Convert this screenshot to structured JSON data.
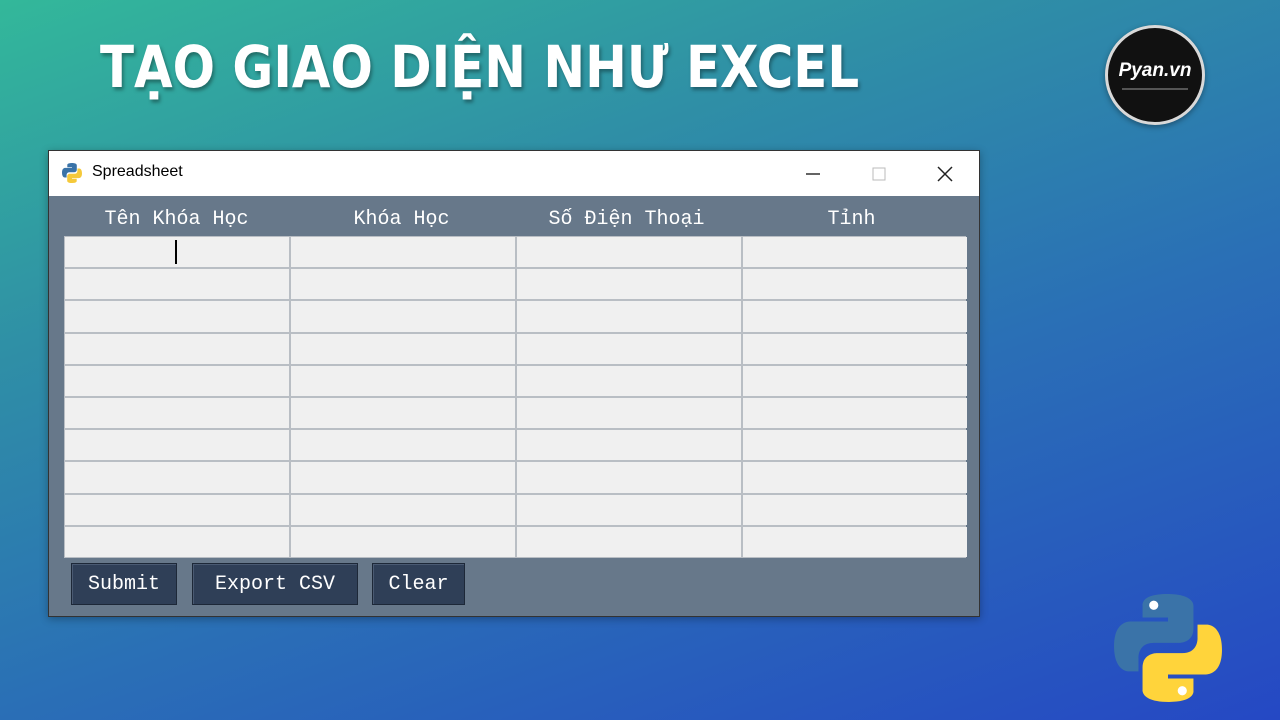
{
  "headline": "TẠO GIAO DIỆN NHƯ EXCEL",
  "logo": {
    "text": "Pyan.vn"
  },
  "window": {
    "title": "Spreadsheet",
    "icon": "python-app-icon",
    "controls": {
      "minimize": "minimize-icon",
      "maximize": "maximize-icon",
      "close": "close-icon"
    }
  },
  "table": {
    "headers": [
      "Tên Khóa Học",
      "Khóa Học",
      "Số Điện Thoại",
      "Tỉnh"
    ],
    "row_count": 10,
    "rows": [
      [
        "",
        "",
        "",
        ""
      ],
      [
        "",
        "",
        "",
        ""
      ],
      [
        "",
        "",
        "",
        ""
      ],
      [
        "",
        "",
        "",
        ""
      ],
      [
        "",
        "",
        "",
        ""
      ],
      [
        "",
        "",
        "",
        ""
      ],
      [
        "",
        "",
        "",
        ""
      ],
      [
        "",
        "",
        "",
        ""
      ],
      [
        "",
        "",
        "",
        ""
      ],
      [
        "",
        "",
        "",
        ""
      ]
    ]
  },
  "buttons": {
    "submit": "Submit",
    "export": "Export CSV",
    "clear": "Clear"
  },
  "colors": {
    "window_bg": "#67788a",
    "button_bg": "#2f3f57",
    "cell_bg": "#f0f0f0",
    "python_blue": "#3a73a8",
    "python_yellow": "#ffd43b"
  }
}
